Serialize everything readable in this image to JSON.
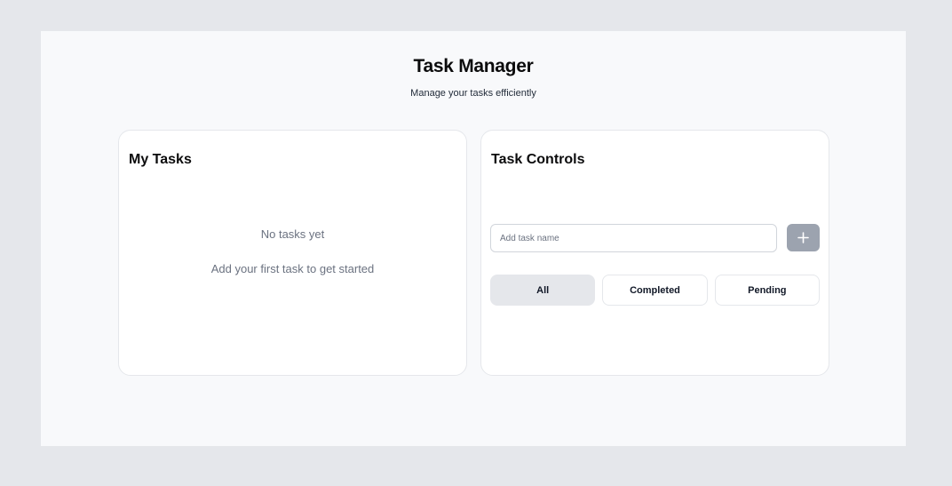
{
  "header": {
    "title": "Task Manager",
    "subtitle": "Manage your tasks efficiently"
  },
  "tasks_panel": {
    "title": "My Tasks",
    "empty_title": "No tasks yet",
    "empty_hint": "Add your first task to get started"
  },
  "controls_panel": {
    "title": "Task Controls",
    "input": {
      "placeholder": "Add task name",
      "value": ""
    },
    "add_button": {
      "icon": "plus-icon"
    },
    "filters": [
      {
        "label": "All",
        "active": true
      },
      {
        "label": "Completed",
        "active": false
      },
      {
        "label": "Pending",
        "active": false
      }
    ]
  },
  "colors": {
    "page_background": "#e5e7eb",
    "frame_background": "#f8f9fb",
    "add_button": "#9ca3af",
    "active_filter": "#e5e7eb",
    "muted_text": "#6b7280"
  }
}
